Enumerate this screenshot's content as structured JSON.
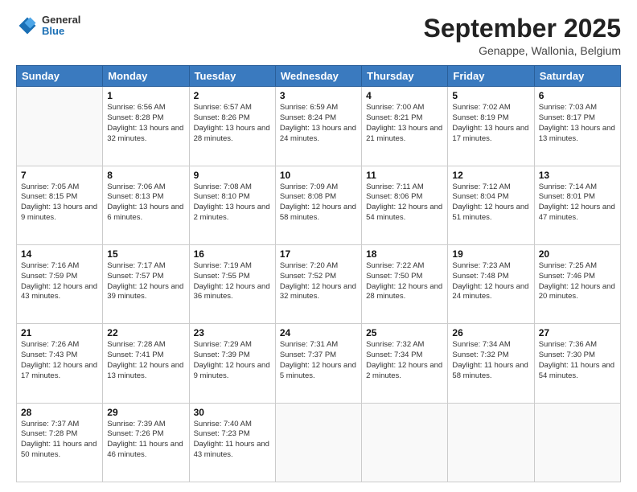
{
  "header": {
    "logo": {
      "general": "General",
      "blue": "Blue"
    },
    "title": "September 2025",
    "subtitle": "Genappe, Wallonia, Belgium"
  },
  "weekdays": [
    "Sunday",
    "Monday",
    "Tuesday",
    "Wednesday",
    "Thursday",
    "Friday",
    "Saturday"
  ],
  "weeks": [
    [
      {
        "day": null,
        "info": null
      },
      {
        "day": "1",
        "sunrise": "Sunrise: 6:56 AM",
        "sunset": "Sunset: 8:28 PM",
        "daylight": "Daylight: 13 hours and 32 minutes."
      },
      {
        "day": "2",
        "sunrise": "Sunrise: 6:57 AM",
        "sunset": "Sunset: 8:26 PM",
        "daylight": "Daylight: 13 hours and 28 minutes."
      },
      {
        "day": "3",
        "sunrise": "Sunrise: 6:59 AM",
        "sunset": "Sunset: 8:24 PM",
        "daylight": "Daylight: 13 hours and 24 minutes."
      },
      {
        "day": "4",
        "sunrise": "Sunrise: 7:00 AM",
        "sunset": "Sunset: 8:21 PM",
        "daylight": "Daylight: 13 hours and 21 minutes."
      },
      {
        "day": "5",
        "sunrise": "Sunrise: 7:02 AM",
        "sunset": "Sunset: 8:19 PM",
        "daylight": "Daylight: 13 hours and 17 minutes."
      },
      {
        "day": "6",
        "sunrise": "Sunrise: 7:03 AM",
        "sunset": "Sunset: 8:17 PM",
        "daylight": "Daylight: 13 hours and 13 minutes."
      }
    ],
    [
      {
        "day": "7",
        "sunrise": "Sunrise: 7:05 AM",
        "sunset": "Sunset: 8:15 PM",
        "daylight": "Daylight: 13 hours and 9 minutes."
      },
      {
        "day": "8",
        "sunrise": "Sunrise: 7:06 AM",
        "sunset": "Sunset: 8:13 PM",
        "daylight": "Daylight: 13 hours and 6 minutes."
      },
      {
        "day": "9",
        "sunrise": "Sunrise: 7:08 AM",
        "sunset": "Sunset: 8:10 PM",
        "daylight": "Daylight: 13 hours and 2 minutes."
      },
      {
        "day": "10",
        "sunrise": "Sunrise: 7:09 AM",
        "sunset": "Sunset: 8:08 PM",
        "daylight": "Daylight: 12 hours and 58 minutes."
      },
      {
        "day": "11",
        "sunrise": "Sunrise: 7:11 AM",
        "sunset": "Sunset: 8:06 PM",
        "daylight": "Daylight: 12 hours and 54 minutes."
      },
      {
        "day": "12",
        "sunrise": "Sunrise: 7:12 AM",
        "sunset": "Sunset: 8:04 PM",
        "daylight": "Daylight: 12 hours and 51 minutes."
      },
      {
        "day": "13",
        "sunrise": "Sunrise: 7:14 AM",
        "sunset": "Sunset: 8:01 PM",
        "daylight": "Daylight: 12 hours and 47 minutes."
      }
    ],
    [
      {
        "day": "14",
        "sunrise": "Sunrise: 7:16 AM",
        "sunset": "Sunset: 7:59 PM",
        "daylight": "Daylight: 12 hours and 43 minutes."
      },
      {
        "day": "15",
        "sunrise": "Sunrise: 7:17 AM",
        "sunset": "Sunset: 7:57 PM",
        "daylight": "Daylight: 12 hours and 39 minutes."
      },
      {
        "day": "16",
        "sunrise": "Sunrise: 7:19 AM",
        "sunset": "Sunset: 7:55 PM",
        "daylight": "Daylight: 12 hours and 36 minutes."
      },
      {
        "day": "17",
        "sunrise": "Sunrise: 7:20 AM",
        "sunset": "Sunset: 7:52 PM",
        "daylight": "Daylight: 12 hours and 32 minutes."
      },
      {
        "day": "18",
        "sunrise": "Sunrise: 7:22 AM",
        "sunset": "Sunset: 7:50 PM",
        "daylight": "Daylight: 12 hours and 28 minutes."
      },
      {
        "day": "19",
        "sunrise": "Sunrise: 7:23 AM",
        "sunset": "Sunset: 7:48 PM",
        "daylight": "Daylight: 12 hours and 24 minutes."
      },
      {
        "day": "20",
        "sunrise": "Sunrise: 7:25 AM",
        "sunset": "Sunset: 7:46 PM",
        "daylight": "Daylight: 12 hours and 20 minutes."
      }
    ],
    [
      {
        "day": "21",
        "sunrise": "Sunrise: 7:26 AM",
        "sunset": "Sunset: 7:43 PM",
        "daylight": "Daylight: 12 hours and 17 minutes."
      },
      {
        "day": "22",
        "sunrise": "Sunrise: 7:28 AM",
        "sunset": "Sunset: 7:41 PM",
        "daylight": "Daylight: 12 hours and 13 minutes."
      },
      {
        "day": "23",
        "sunrise": "Sunrise: 7:29 AM",
        "sunset": "Sunset: 7:39 PM",
        "daylight": "Daylight: 12 hours and 9 minutes."
      },
      {
        "day": "24",
        "sunrise": "Sunrise: 7:31 AM",
        "sunset": "Sunset: 7:37 PM",
        "daylight": "Daylight: 12 hours and 5 minutes."
      },
      {
        "day": "25",
        "sunrise": "Sunrise: 7:32 AM",
        "sunset": "Sunset: 7:34 PM",
        "daylight": "Daylight: 12 hours and 2 minutes."
      },
      {
        "day": "26",
        "sunrise": "Sunrise: 7:34 AM",
        "sunset": "Sunset: 7:32 PM",
        "daylight": "Daylight: 11 hours and 58 minutes."
      },
      {
        "day": "27",
        "sunrise": "Sunrise: 7:36 AM",
        "sunset": "Sunset: 7:30 PM",
        "daylight": "Daylight: 11 hours and 54 minutes."
      }
    ],
    [
      {
        "day": "28",
        "sunrise": "Sunrise: 7:37 AM",
        "sunset": "Sunset: 7:28 PM",
        "daylight": "Daylight: 11 hours and 50 minutes."
      },
      {
        "day": "29",
        "sunrise": "Sunrise: 7:39 AM",
        "sunset": "Sunset: 7:26 PM",
        "daylight": "Daylight: 11 hours and 46 minutes."
      },
      {
        "day": "30",
        "sunrise": "Sunrise: 7:40 AM",
        "sunset": "Sunset: 7:23 PM",
        "daylight": "Daylight: 11 hours and 43 minutes."
      },
      {
        "day": null,
        "info": null
      },
      {
        "day": null,
        "info": null
      },
      {
        "day": null,
        "info": null
      },
      {
        "day": null,
        "info": null
      }
    ]
  ]
}
